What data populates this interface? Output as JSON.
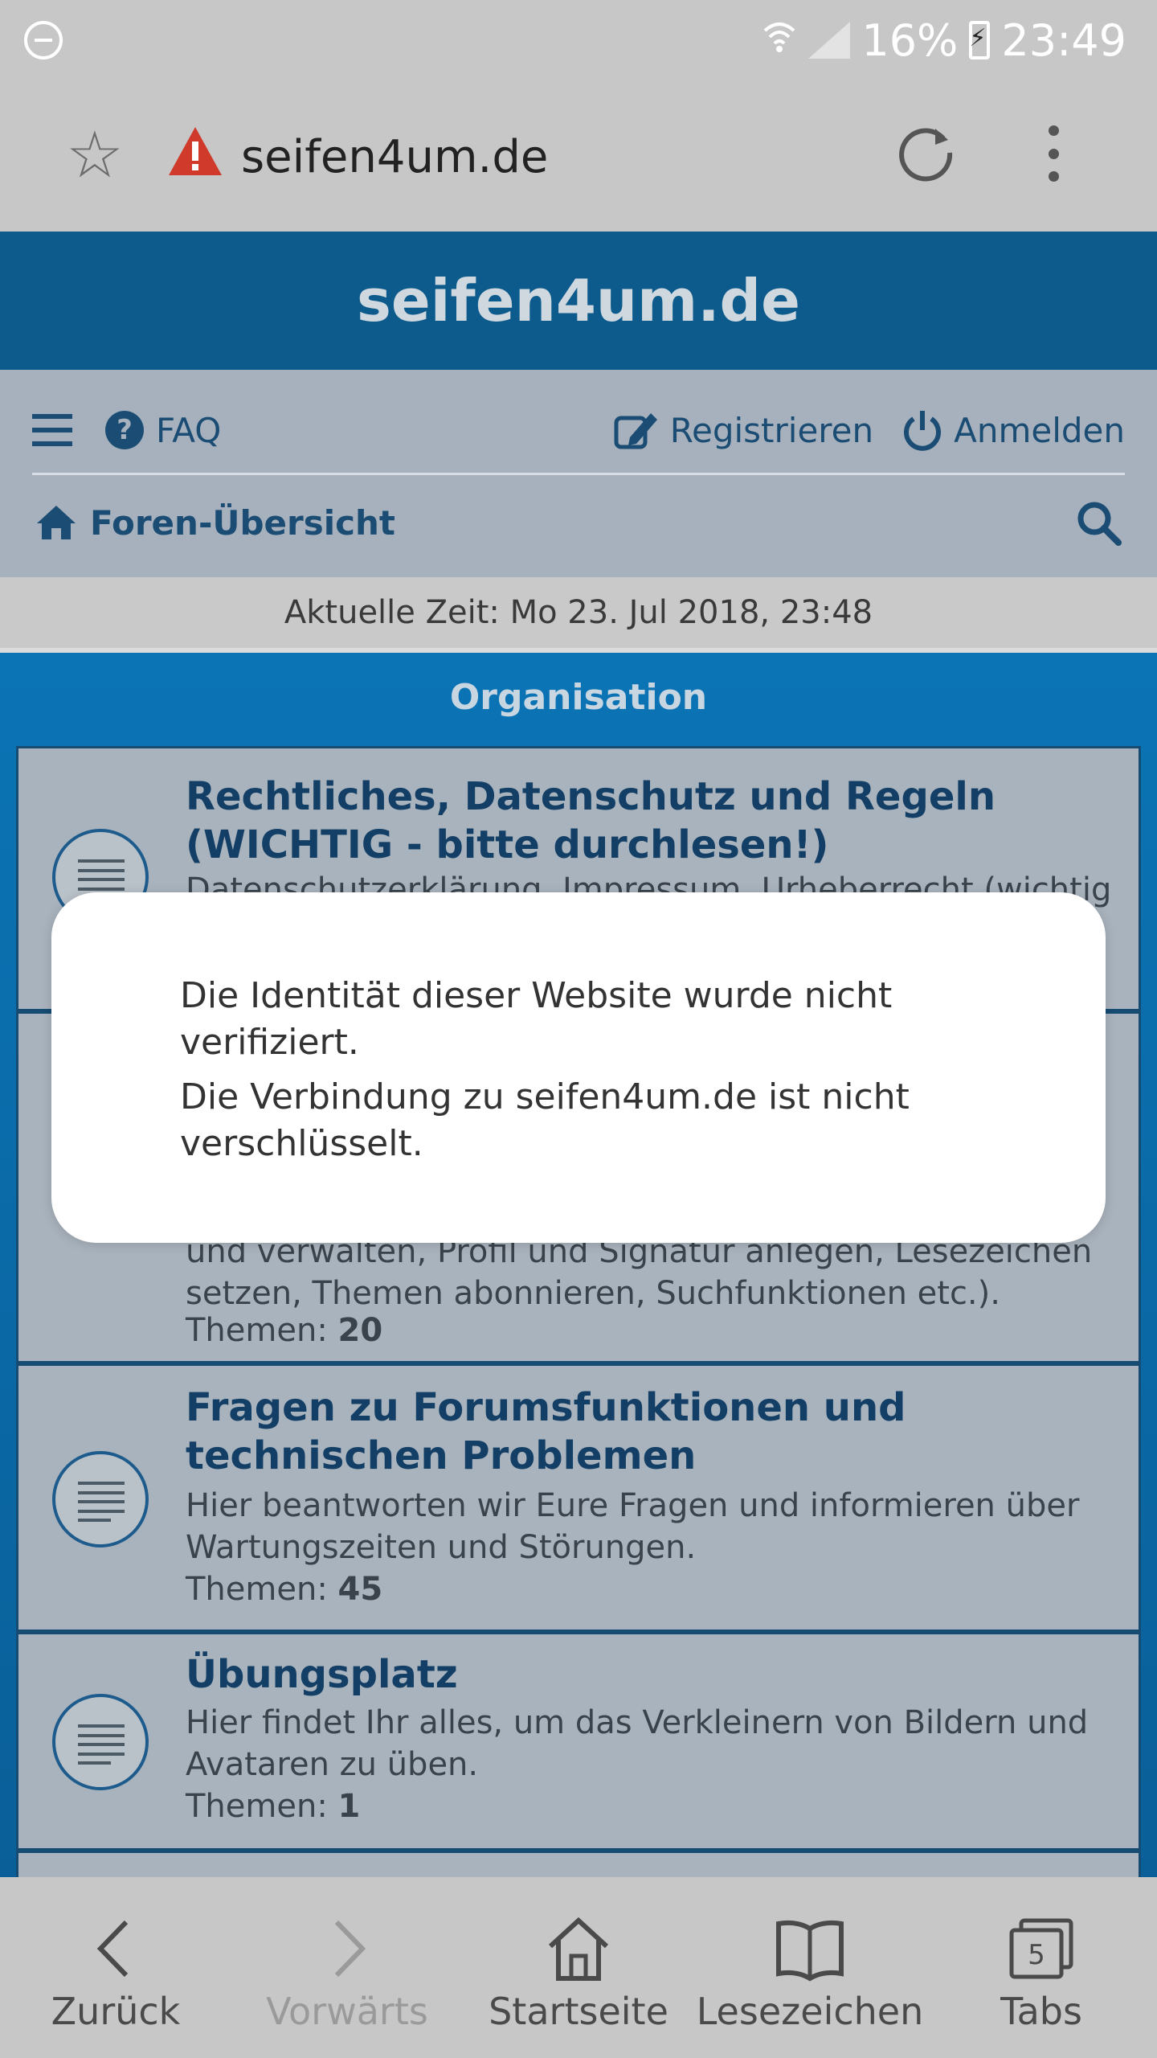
{
  "status_bar": {
    "battery": "16%",
    "time": "23:49"
  },
  "browser": {
    "url": "seifen4um.de"
  },
  "site": {
    "title": "seifen4um.de"
  },
  "nav": {
    "faq": "FAQ",
    "register": "Registrieren",
    "login": "Anmelden",
    "breadcrumb": "Foren-Übersicht"
  },
  "current_time": "Aktuelle Zeit: Mo 23. Jul 2018, 23:48",
  "forum": {
    "heading": "Organisation",
    "rows": [
      {
        "title": "Rechtliches, Datenschutz und Regeln (WICHTIG - bitte durchlesen!)",
        "desc": "Datenschutzerklärung, Impressum, Urheberrecht (wichtig"
      },
      {
        "desc": "und verwalten, Profil und Signatur anlegen, Lesezeichen setzen, Themen abonnieren, Suchfunktionen etc.).",
        "count_label": "Themen:",
        "count": "20"
      },
      {
        "title": "Fragen zu Forumsfunktionen und technischen Problemen",
        "desc": "Hier beantworten wir Eure Fragen und informieren über Wartungszeiten und Störungen.",
        "count_label": "Themen:",
        "count": "45"
      },
      {
        "title": "Übungsplatz",
        "desc": "Hier findet Ihr alles, um das Verkleinern von Bildern und Avataren zu üben.",
        "count_label": "Themen:",
        "count": "1"
      }
    ]
  },
  "dialog": {
    "line1": "Die Identität dieser Website wurde nicht verifiziert.",
    "line2": "Die Verbindung zu seifen4um.de ist nicht verschlüsselt."
  },
  "bottom_nav": {
    "back": "Zurück",
    "forward": "Vorwärts",
    "home": "Startseite",
    "bookmarks": "Lesezeichen",
    "tabs": "Tabs",
    "tab_count": "5"
  }
}
